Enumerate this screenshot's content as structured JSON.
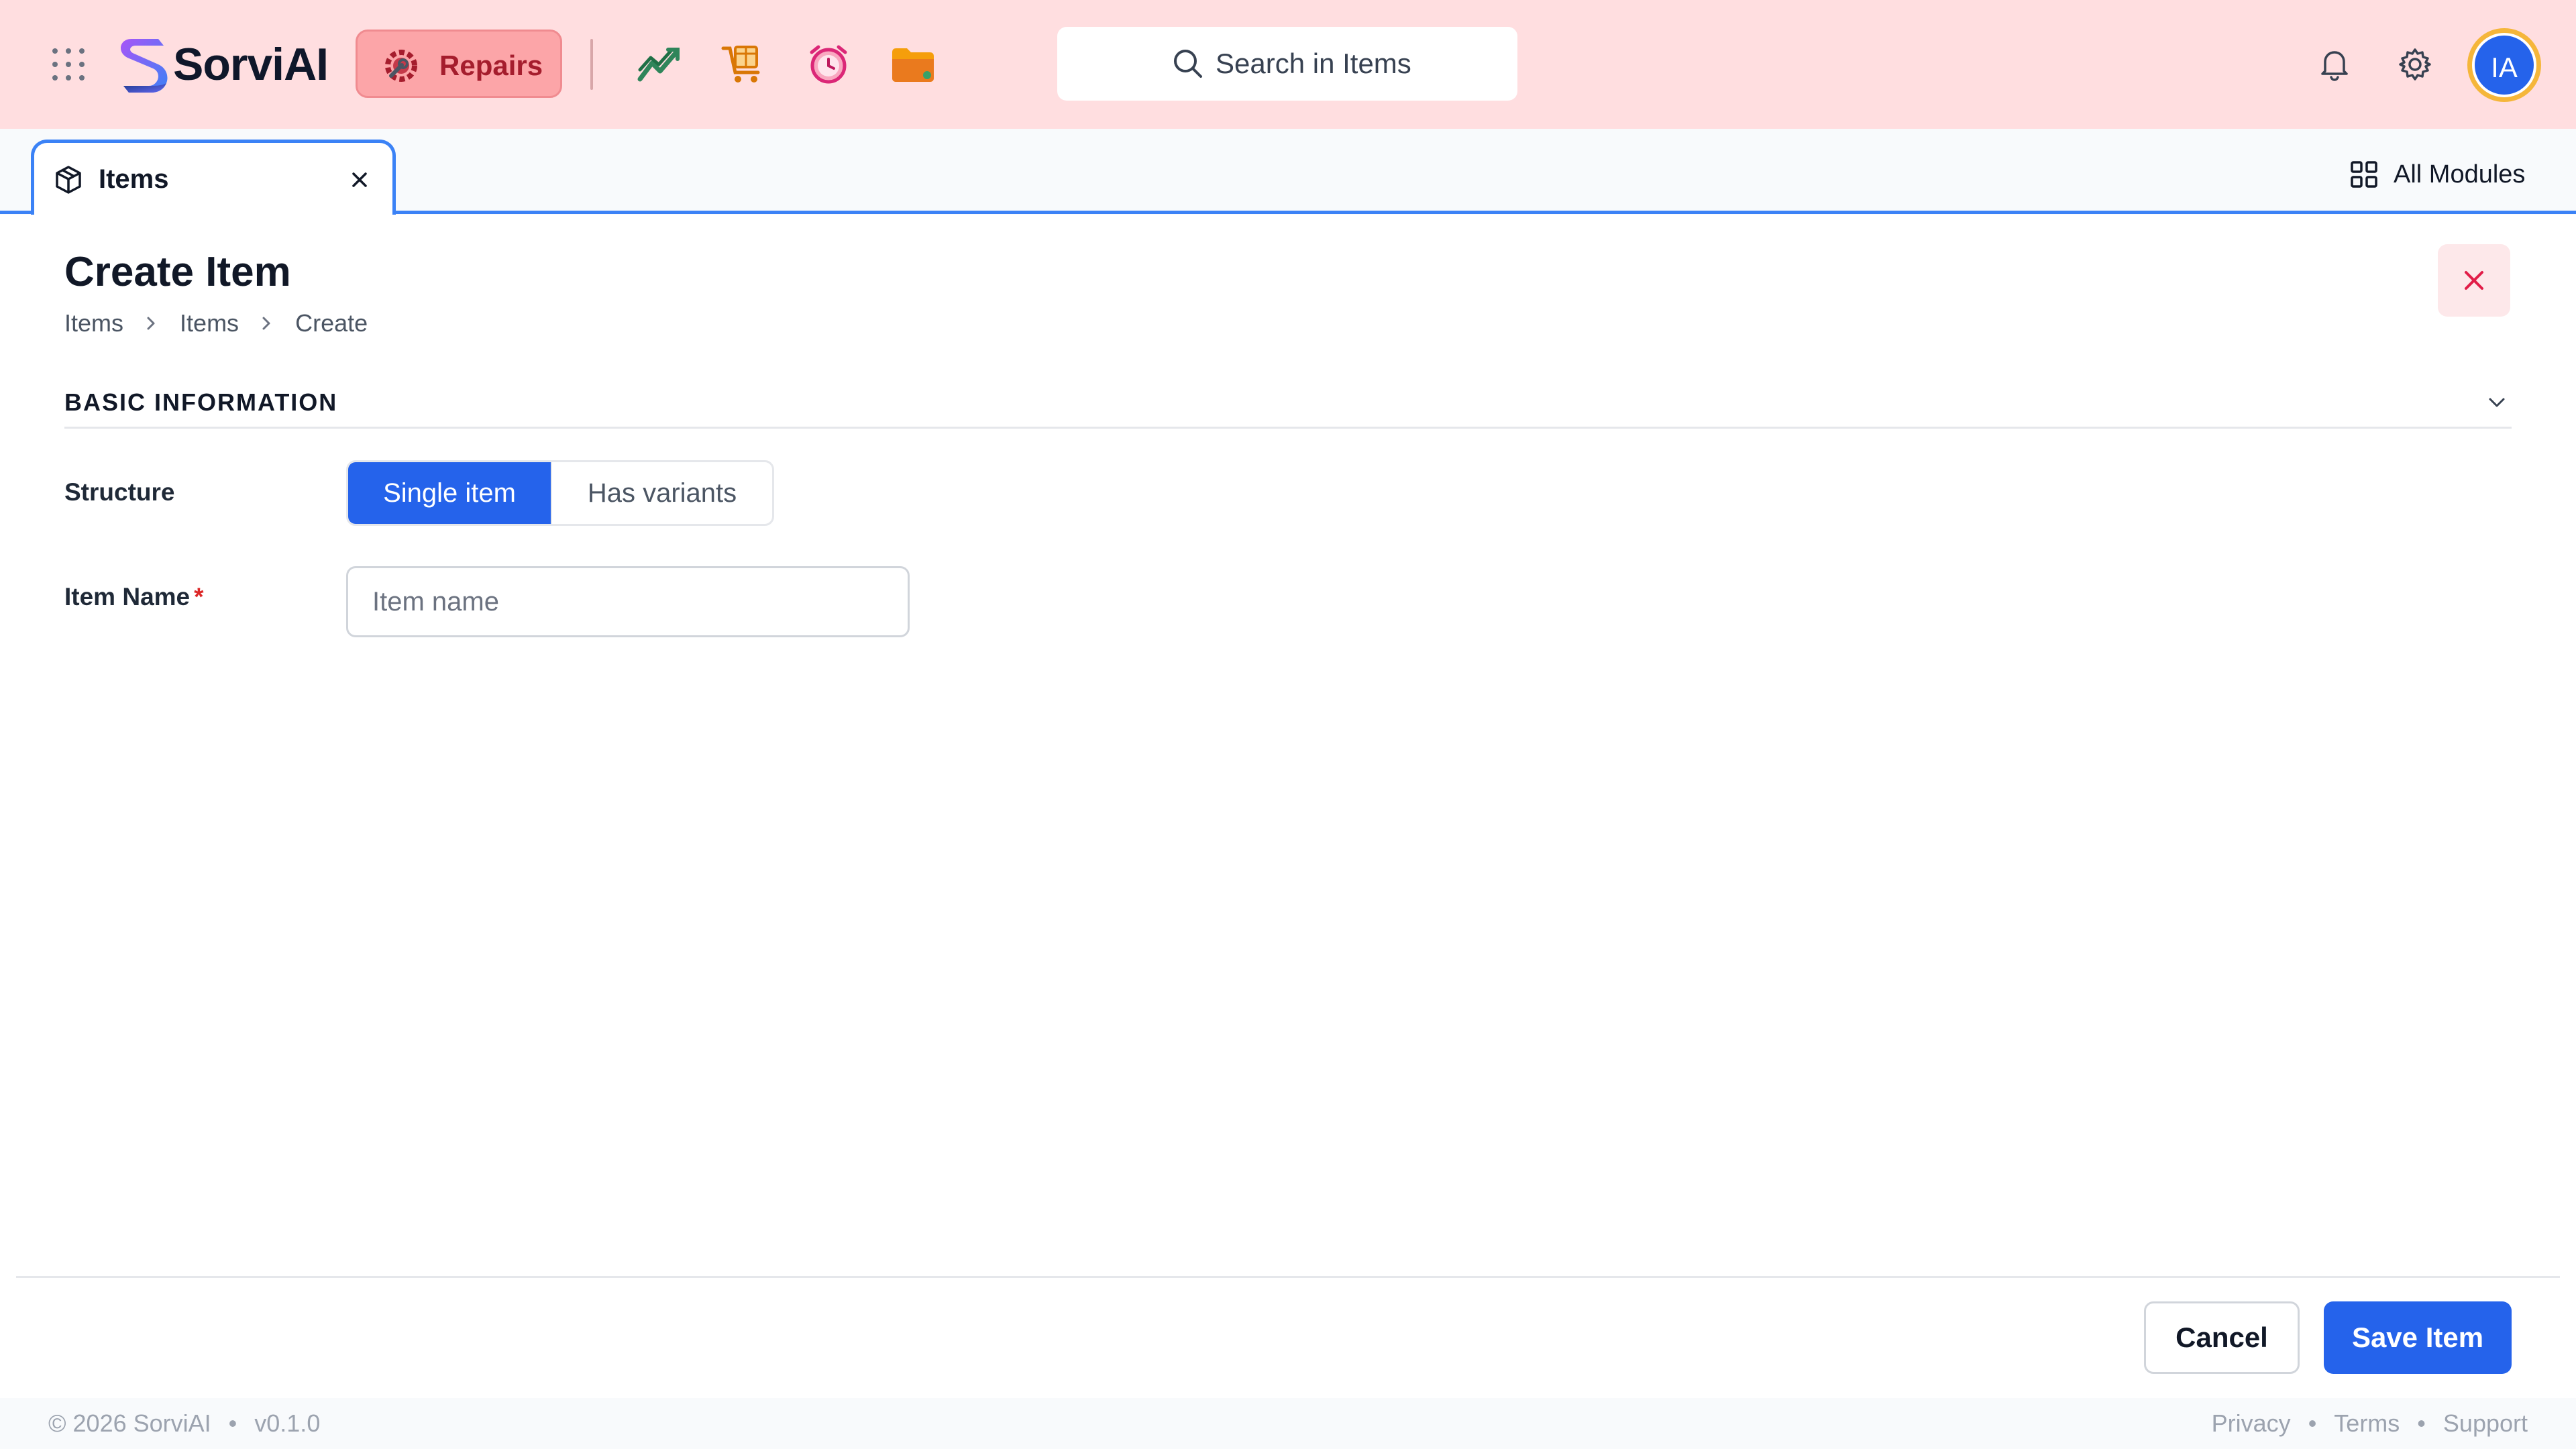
{
  "topbar": {
    "brand": "SorviAI",
    "module": {
      "label": "Repairs",
      "icon": "repairs-gear-icon"
    },
    "quick_icons": [
      "sales-chart-icon",
      "cart-box-icon",
      "alarm-clock-icon",
      "folder-icon"
    ],
    "search": {
      "placeholder": "Search in Items"
    },
    "avatar": {
      "initials": "IA"
    },
    "colors": {
      "bar": "#ffdee0",
      "pill": "#fca5a8",
      "pill_text": "#a51d2d",
      "avatar": "#2563eb",
      "avatar_ring": "#f5b63a"
    }
  },
  "tabs": [
    {
      "label": "Items",
      "icon": "box-icon",
      "active": true
    }
  ],
  "all_modules": {
    "label": "All Modules"
  },
  "page": {
    "title": "Create Item",
    "breadcrumb": [
      "Items",
      "Items",
      "Create"
    ]
  },
  "section": {
    "title": "BASIC INFORMATION",
    "structure": {
      "label": "Structure",
      "options": [
        "Single item",
        "Has variants"
      ],
      "selected": "Single item"
    },
    "item_name": {
      "label": "Item Name",
      "required_mark": "*",
      "value": "",
      "placeholder": "Item name"
    }
  },
  "actions": {
    "cancel": "Cancel",
    "save": "Save Item"
  },
  "statusbar": {
    "copyright": "© 2026 SorviAI",
    "separator": "•",
    "version": "v0.1.0",
    "links": [
      "Privacy",
      "Terms",
      "Support"
    ]
  },
  "accent": "#2563eb"
}
